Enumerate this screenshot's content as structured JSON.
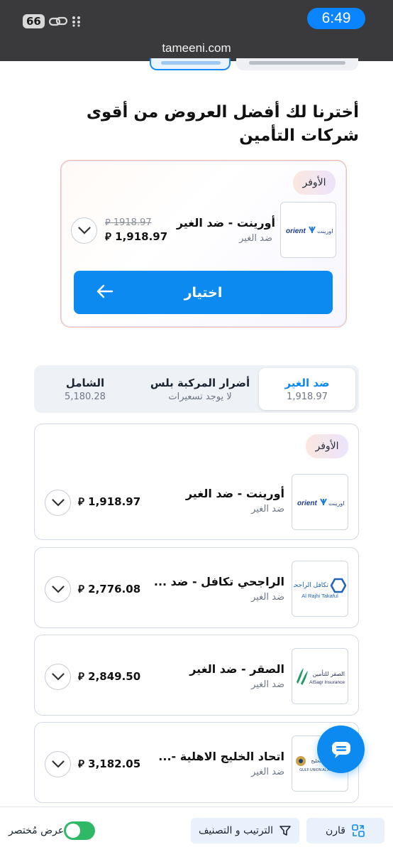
{
  "status_bar": {
    "battery": "66",
    "time": "6:49",
    "url": "tameeni.com"
  },
  "hero": {
    "title": "أخترنا لك أفضل العروض من أقوى شركات التأمين"
  },
  "best_offer": {
    "badge": "الأوفر",
    "logo_text": "orient",
    "name": "أورينت - ضد الغير",
    "type": "ضد الغير",
    "old_price": "1918.97",
    "price": "1,918.97",
    "select_label": "اختيار"
  },
  "tabs": [
    {
      "title": "ضد الغير",
      "subtitle": "1,918.97",
      "active": true
    },
    {
      "title": "أضرار المركبة بلس",
      "subtitle": "لا يوجد تسعيرات",
      "active": false
    },
    {
      "title": "الشامل",
      "subtitle": "5,180.28",
      "active": false
    }
  ],
  "quotes": [
    {
      "badge": "الأوفر",
      "logo": "orient",
      "logo_text": "orient",
      "name": "أورينت - ضد الغير",
      "type": "ضد الغير",
      "price": "1,918.97"
    },
    {
      "badge": "",
      "logo": "alrajhi",
      "logo_text": "Al Rajhi Takaful",
      "logo_text_ar": "تكافل الراجحي",
      "name": "الراجحي تكافل - ضد ...",
      "type": "ضد الغير",
      "price": "2,776.08"
    },
    {
      "badge": "",
      "logo": "alsagr",
      "logo_text": "AlSagr Insurance",
      "logo_text_ar": "الصقر للتأمين",
      "name": "الصقر - ضد الغير",
      "type": "ضد الغير",
      "price": "2,849.50"
    },
    {
      "badge": "",
      "logo": "gulfunion",
      "logo_text": "GULF UNION AL AHLIA CO.",
      "name": "اتحاد الخليج الاهلية -...",
      "type": "ضد الغير",
      "price": "3,182.05"
    }
  ],
  "bottom_bar": {
    "compare": "قارن",
    "sort": "الترتيب و التصنيف",
    "compact_view": "عرض مُختصر",
    "compact_on": true
  },
  "colors": {
    "primary": "#0d8af0",
    "toggle": "#2fb866",
    "status_bar": "#3a3a3c"
  }
}
